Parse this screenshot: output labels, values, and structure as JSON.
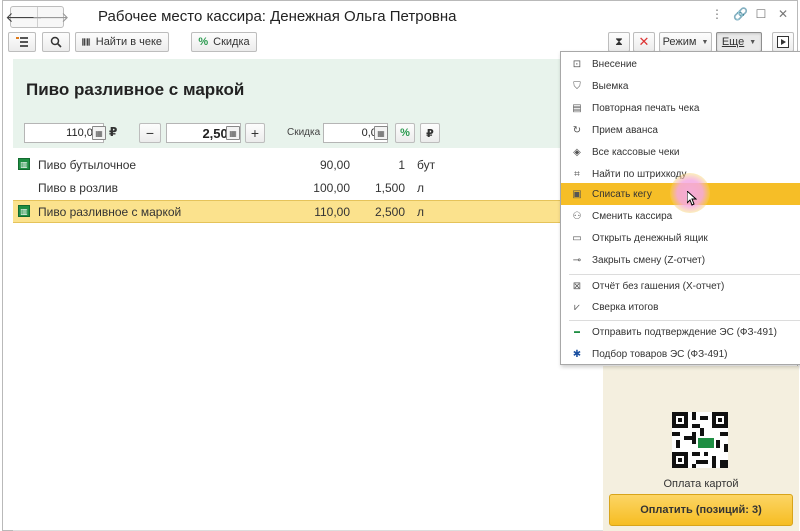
{
  "window": {
    "title": "Рабочее место кассира: Денежная Ольга Петровна",
    "back_icon": "arrow-left-icon",
    "forward_icon": "arrow-right-icon",
    "controls": [
      "⋮",
      "🔗",
      "☐",
      "✕"
    ]
  },
  "toolbar": {
    "find_in_receipt": "Найти в чеке",
    "discount": "Скидка",
    "mode": "Режим",
    "more": "Еще",
    "icons": {
      "list": "list-icon",
      "search": "search-icon",
      "barcode": "barcode-icon",
      "discount": "percent-icon",
      "hourglass": "hourglass-icon",
      "clear": "clear-icon",
      "display": "display-icon"
    }
  },
  "product": {
    "name": "Пиво разливное с маркой",
    "price": "110,00",
    "currency": "₽",
    "quantity": "2,500",
    "discount_label": "Скидка",
    "discount_value": "0,00",
    "minus": "−",
    "plus": "+",
    "percent": "%",
    "rub": "₽"
  },
  "items": [
    {
      "name": "Пиво бутылочное",
      "price": "90,00",
      "qty": "1",
      "unit": "бут",
      "marked": true,
      "selected": false
    },
    {
      "name": "Пиво в розлив",
      "price": "100,00",
      "qty": "1,500",
      "unit": "л",
      "marked": false,
      "selected": false
    },
    {
      "name": "Пиво разливное с маркой",
      "price": "110,00",
      "qty": "2,500",
      "unit": "л",
      "marked": true,
      "selected": true
    }
  ],
  "payment": {
    "qr_caption": "Оплата картой",
    "pay_button": "Оплатить (позиций: 3)"
  },
  "menu": {
    "items": [
      {
        "label": "Внесение",
        "icon": "deposit-icon"
      },
      {
        "label": "Выемка",
        "icon": "withdrawal-icon"
      },
      {
        "label": "Повторная печать чека",
        "icon": "reprint-icon"
      },
      {
        "label": "Прием аванса",
        "icon": "advance-icon"
      },
      {
        "label": "Все кассовые чеки",
        "icon": "receipts-icon"
      },
      {
        "label": "Найти по штрихкоду",
        "icon": "scan-barcode-icon"
      },
      {
        "label": "Списать кегу",
        "icon": "keg-icon",
        "highlighted": true
      },
      {
        "label": "Сменить кассира",
        "icon": "user-icon"
      },
      {
        "label": "Открыть денежный ящик",
        "icon": "cash-drawer-icon"
      },
      {
        "label": "Закрыть смену (Z-отчет)",
        "icon": "close-shift-icon"
      },
      {
        "label": "Отчёт без гашения (X-отчет)",
        "icon": "report-icon"
      },
      {
        "label": "Сверка итогов",
        "icon": "reconcile-icon"
      },
      {
        "label": "Отправить подтверждение ЭС (ФЗ-491)",
        "icon": "egais-icon"
      },
      {
        "label": "Подбор товаров ЭС (ФЗ-491)",
        "icon": "snowflake-icon"
      }
    ]
  },
  "colors": {
    "accent": "#f6be27",
    "selected_row": "#fbe28d",
    "product_panel": "#e8f3ec",
    "right_panel": "#f4efdf"
  }
}
